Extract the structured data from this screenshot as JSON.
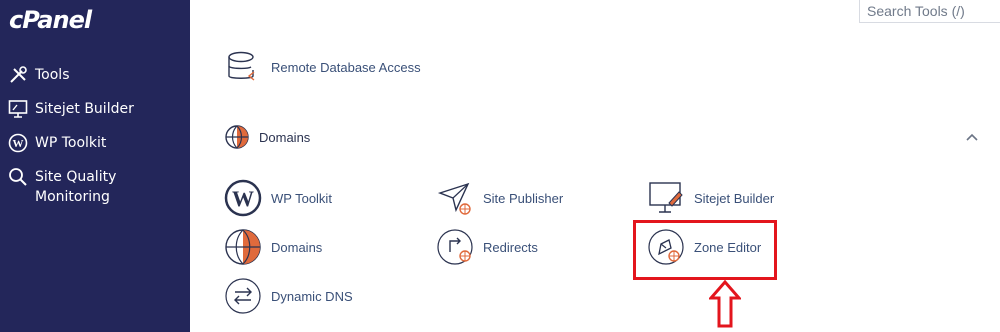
{
  "sidebar": {
    "logo": "cPanel",
    "items": [
      {
        "label": "Tools",
        "icon": "tools-icon"
      },
      {
        "label": "Sitejet Builder",
        "icon": "monitor-icon"
      },
      {
        "label": "WP Toolkit",
        "icon": "wordpress-icon"
      },
      {
        "label": "Site Quality Monitoring",
        "icon": "magnifier-icon"
      }
    ]
  },
  "search": {
    "placeholder": "Search Tools (/)"
  },
  "databases": {
    "remote_database_access": "Remote Database Access"
  },
  "domains_section": {
    "title": "Domains",
    "tools": [
      {
        "label": "WP Toolkit",
        "icon": "wordpress-icon"
      },
      {
        "label": "Site Publisher",
        "icon": "paper-plane-icon"
      },
      {
        "label": "Sitejet Builder",
        "icon": "monitor-icon"
      },
      {
        "label": "Domains",
        "icon": "globe-icon"
      },
      {
        "label": "Redirects",
        "icon": "redirect-icon"
      },
      {
        "label": "Zone Editor",
        "icon": "zone-editor-icon"
      },
      {
        "label": "Dynamic DNS",
        "icon": "dynamic-dns-icon"
      }
    ]
  },
  "colors": {
    "sidebar_bg": "#23265a",
    "accent": "#e3151d",
    "orange": "#e06a3c"
  }
}
